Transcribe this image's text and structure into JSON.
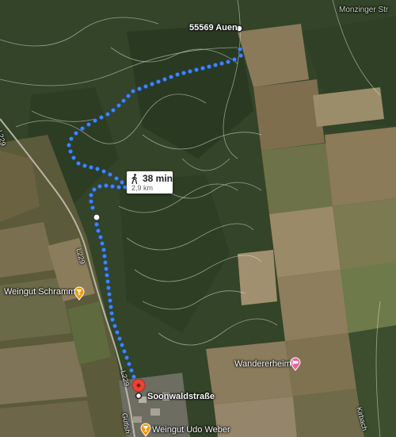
{
  "map": {
    "places": {
      "destination": "55569 Auen",
      "origin": "Soonwaldstraße",
      "winery_1": "Weingut Schramm",
      "winery_2": "Weingut Udo Weber",
      "wandererheim": "Wandererheim",
      "village": "Monzinger Str",
      "stream": "Kirbach",
      "road_1": "L229",
      "road_2": "L229",
      "road_3": "L229",
      "street": "Gutlsh"
    },
    "route": {
      "mode_icon": "walking-person-icon",
      "duration": "38 min",
      "distance": "2,9 km",
      "color": "#4285f4"
    },
    "colors": {
      "origin_pin": "#ea4335",
      "winery_pin": "#f29900",
      "wandererheim_pin": "#e8639a"
    }
  }
}
